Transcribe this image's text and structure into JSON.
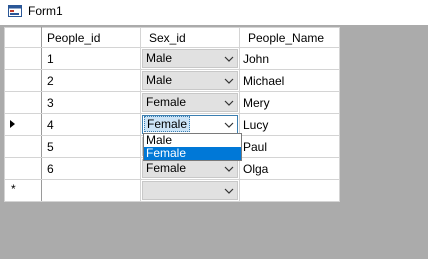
{
  "window": {
    "title": "Form1"
  },
  "grid": {
    "columns": [
      "People_id",
      "Sex_id",
      "People_Name"
    ],
    "rows": [
      {
        "id": "1",
        "sex": "Male",
        "name": "John"
      },
      {
        "id": "2",
        "sex": "Male",
        "name": "Michael"
      },
      {
        "id": "3",
        "sex": "Female",
        "name": "Mery"
      },
      {
        "id": "4",
        "sex": "Female",
        "name": "Lucy"
      },
      {
        "id": "5",
        "sex": "",
        "name": "Paul"
      },
      {
        "id": "6",
        "sex": "Female",
        "name": "Olga"
      }
    ],
    "new_row_marker": "*",
    "current_row_index": 3
  },
  "dropdown": {
    "options": [
      "Male",
      "Female"
    ],
    "highlighted": "Female"
  }
}
